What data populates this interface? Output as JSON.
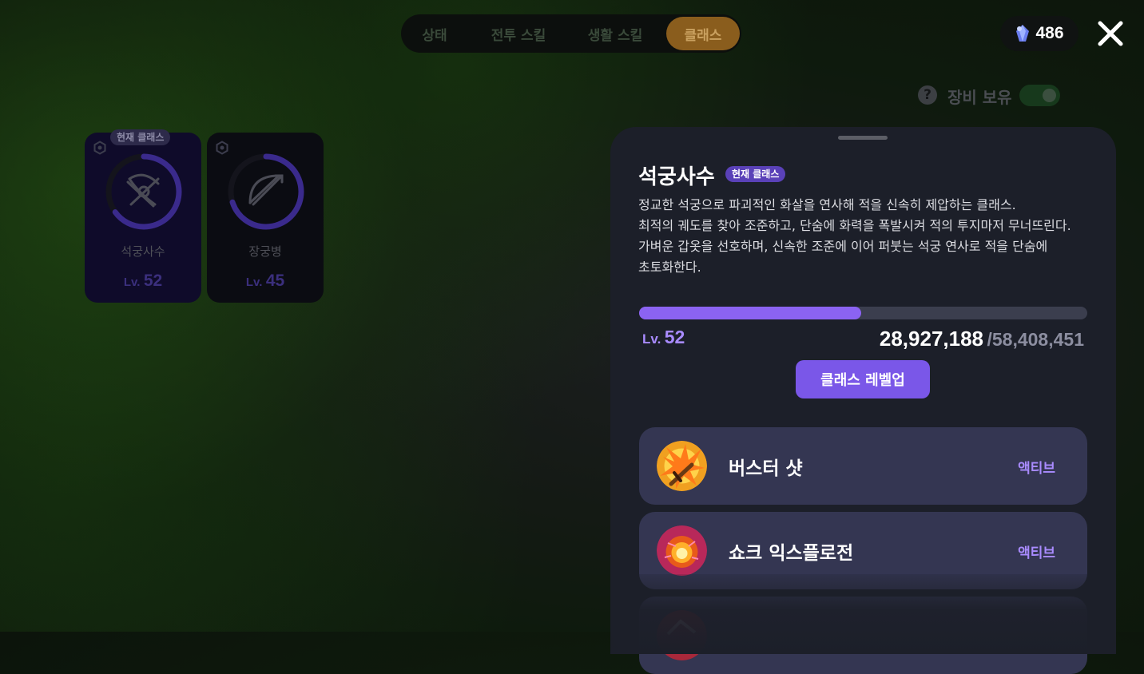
{
  "tabs": [
    {
      "label": "상태",
      "active": false
    },
    {
      "label": "전투 스킬",
      "active": false
    },
    {
      "label": "생활 스킬",
      "active": false
    },
    {
      "label": "클래스",
      "active": true
    }
  ],
  "currency": {
    "icon": "gem-icon",
    "value": "486"
  },
  "close": {
    "icon": "close-icon"
  },
  "equipment_toggle": {
    "label": "장비 보유",
    "help_icon": "question-icon",
    "on": true
  },
  "class_cards": [
    {
      "badge": "현재 클래스",
      "name": "석궁사수",
      "level_prefix": "Lv.",
      "level": "52",
      "icon": "crossbow-icon",
      "progress": 0.65
    },
    {
      "badge": "",
      "name": "장궁병",
      "level_prefix": "Lv.",
      "level": "45",
      "icon": "longbow-icon",
      "progress": 0.7
    }
  ],
  "detail": {
    "title": "석궁사수",
    "badge": "현재 클래스",
    "description": [
      "정교한 석궁으로 파괴적인 화살을 연사해 적을 신속히 제압하는 클래스.",
      "최적의 궤도를 찾아 조준하고, 단숨에 화력을 폭발시켜 적의 투지마저 무너뜨린다.",
      "가벼운 갑옷을 선호하며, 신속한 조준에 이어 퍼붓는 석궁 연사로 적을 단숨에",
      "초토화한다."
    ],
    "level_prefix": "Lv.",
    "level": "52",
    "xp_current": "28,927,188",
    "xp_max": "/58,408,451",
    "xp_progress": 0.495,
    "levelup_label": "클래스 레벨업",
    "skills": [
      {
        "name": "버스터 샷",
        "type": "액티브",
        "icon": "buster-shot-icon"
      },
      {
        "name": "쇼크 익스플로전",
        "type": "액티브",
        "icon": "shock-explosion-icon"
      },
      {
        "name": "",
        "type": "",
        "icon": "skill-icon"
      }
    ]
  },
  "colors": {
    "accent": "#7a57e8",
    "accent_light": "#a98bff",
    "tab_active": "#8a5d1d",
    "panel": "#1c1f29",
    "skill_row": "#343652"
  }
}
